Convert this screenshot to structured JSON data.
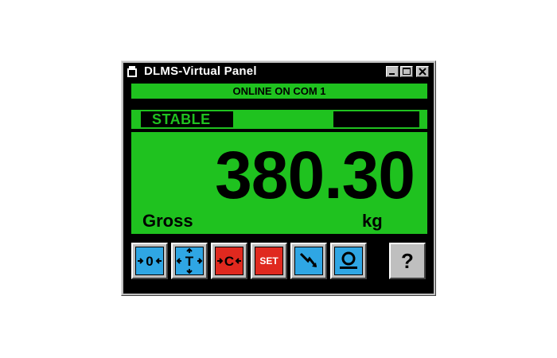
{
  "window": {
    "title": "DLMS-Virtual Panel"
  },
  "titlebar_buttons": [
    "minimize",
    "maximize",
    "close"
  ],
  "status": {
    "connection": "ONLINE ON COM 1",
    "stability": "STABLE"
  },
  "display": {
    "weight": "380.30",
    "mode": "Gross",
    "unit": "kg"
  },
  "buttons": [
    {
      "name": "zero-button",
      "icon": "zero-icon",
      "symbol": "0",
      "color": "#2fa6e4"
    },
    {
      "name": "tare-button",
      "icon": "tare-icon",
      "symbol": "T",
      "color": "#2fa6e4"
    },
    {
      "name": "clear-button",
      "icon": "clear-icon",
      "symbol": "C",
      "color": "#e0291f"
    },
    {
      "name": "set-button",
      "icon": "set-icon",
      "label": "SET",
      "color": "#e0291f"
    },
    {
      "name": "print-button",
      "icon": "print-arrow-icon",
      "color": "#2fa6e4"
    },
    {
      "name": "scale-button",
      "icon": "scale-icon",
      "color": "#2fa6e4"
    },
    {
      "name": "help-button",
      "icon": "question-icon",
      "label": "?",
      "color": "#bfbfbf"
    }
  ],
  "colors": {
    "display_green": "#1fc21f",
    "button_blue": "#2fa6e4",
    "button_red": "#e0291f"
  }
}
